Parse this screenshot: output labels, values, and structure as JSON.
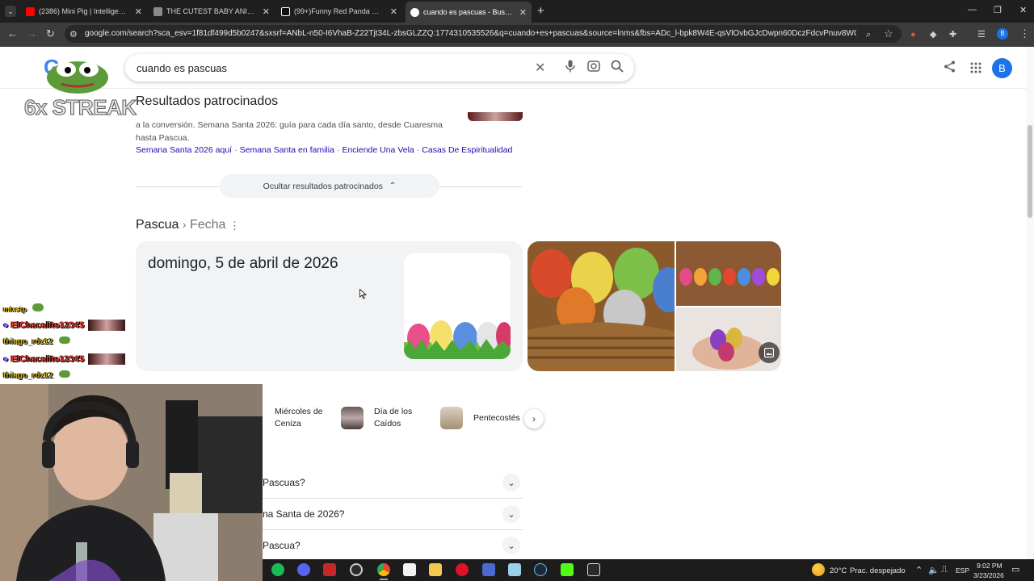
{
  "browser": {
    "tabs": [
      {
        "title": "(2386) Mini Pig | Intelligent Littl",
        "favicon_color": "#ff0000"
      },
      {
        "title": "THE CUTEST BABY ANIMAL Bra",
        "favicon_color": "#c9c9c9"
      },
      {
        "title": "(99+)Funny Red Panda Momen",
        "favicon_color": "#ffffff"
      },
      {
        "title": "cuando es pascuas - Buscar con",
        "favicon_color": "#4285f4"
      }
    ],
    "new_tab": "+",
    "url": "google.com/search?sca_esv=1f81df499d5b0247&sxsrf=ANbL-n50-I6VhaB-Z22Tjt34L-zbsGLZZQ:1774310535526&q=cuando+es+pascuas&source=lnms&fbs=ADc_l-bpk8W4E-qsVlOvbGJcDwpn60DczFdcvPnuv8WQohHLTbSVldBrj9...",
    "profile_initial": "B"
  },
  "google": {
    "logo_letter": "G",
    "query": "cuando es pascuas",
    "profile_initial": "B"
  },
  "sponsored": {
    "title": "Resultados patrocinados",
    "description": "a la conversión. Semana Santa 2026: guía para cada día santo, desde Cuaresma hasta Pascua.",
    "links": [
      "Semana Santa 2026 aquí",
      "Semana Santa en familia",
      "Enciende Una Vela",
      "Casas De Espiritualidad"
    ],
    "hide_label": "Ocultar resultados patrocinados"
  },
  "answer": {
    "crumb_entity": "Pascua",
    "crumb_sep": "›",
    "crumb_attr": "Fecha",
    "date": "domingo, 5 de abril de 2026"
  },
  "related": [
    {
      "label": "Miércoles de Ceniza"
    },
    {
      "label": "Día de los Caídos"
    },
    {
      "label": "Pentecostés"
    }
  ],
  "faq": [
    {
      "question": "Pascuas?"
    },
    {
      "question": "na Santa de 2026?"
    },
    {
      "question": "Pascua?"
    }
  ],
  "overlay": {
    "streak": "6x STREAK",
    "chat": [
      {
        "user": "mixstp",
        "color": "#e8c020"
      },
      {
        "user": "ElChacalito12345",
        "color": "#e33b2e"
      },
      {
        "user": "thiago_rdz12",
        "color": "#c9b227"
      },
      {
        "user": "ElChacalito12345",
        "color": "#e33b2e"
      },
      {
        "user": "thiago_rdz12",
        "color": "#c9b227"
      }
    ]
  },
  "taskbar": {
    "weather_temp": "20°C",
    "weather_desc": "Prac. despejado",
    "lang": "ESP",
    "time": "9:02 PM",
    "date": "3/23/2026"
  }
}
